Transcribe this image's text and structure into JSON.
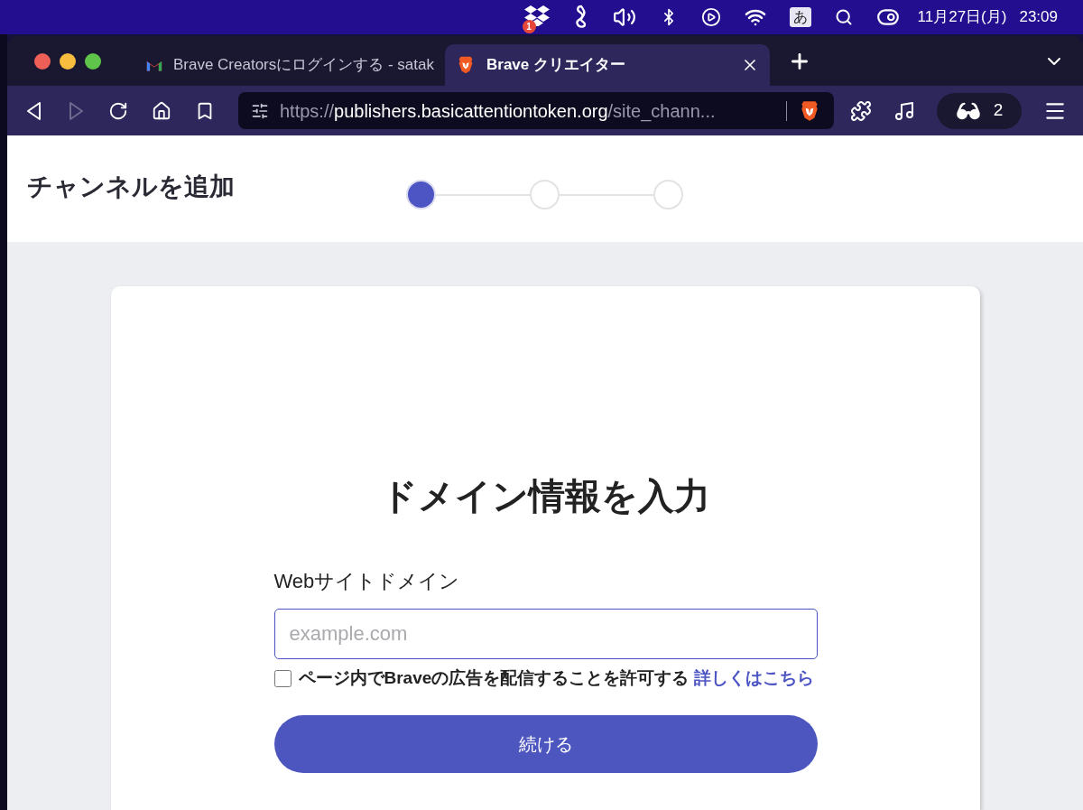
{
  "menu_bar": {
    "items": [
      {
        "kind": "dropbox",
        "badge": "1"
      },
      {
        "kind": "figure"
      },
      {
        "kind": "volume"
      },
      {
        "kind": "bluetooth"
      },
      {
        "kind": "play"
      },
      {
        "kind": "wifi"
      },
      {
        "kind": "input",
        "label": "あ"
      },
      {
        "kind": "search"
      },
      {
        "kind": "control"
      }
    ],
    "date": "11月27日(月)",
    "time": "23:09"
  },
  "browser": {
    "tabs": [
      {
        "kind": "gmail",
        "title": "Brave Creatorsにログインする - satak",
        "selected": false
      },
      {
        "kind": "brave",
        "title": "Brave クリエイター",
        "selected": true
      }
    ],
    "nav": [
      {
        "kind": "back",
        "disabled": false
      },
      {
        "kind": "forward",
        "disabled": true
      },
      {
        "kind": "reload",
        "disabled": false
      },
      {
        "kind": "home",
        "disabled": false
      },
      {
        "kind": "bookmark",
        "disabled": false
      }
    ],
    "url": {
      "scheme": "https://",
      "host": "publishers.basicattentiontoken.org",
      "path": "/site_chann..."
    },
    "private_count": "2"
  },
  "page": {
    "title": "チャンネルを追加",
    "steps": [
      {
        "selected": true
      },
      {
        "selected": false
      },
      {
        "selected": false
      }
    ],
    "card": {
      "heading": "ドメイン情報を入力",
      "field_label": "Webサイトドメイン",
      "placeholder": "example.com",
      "consent": {
        "checked": false,
        "text": "ページ内でBraveの広告を配信することを許可する",
        "link": "詳しくはこちら"
      },
      "button": "続ける"
    }
  }
}
